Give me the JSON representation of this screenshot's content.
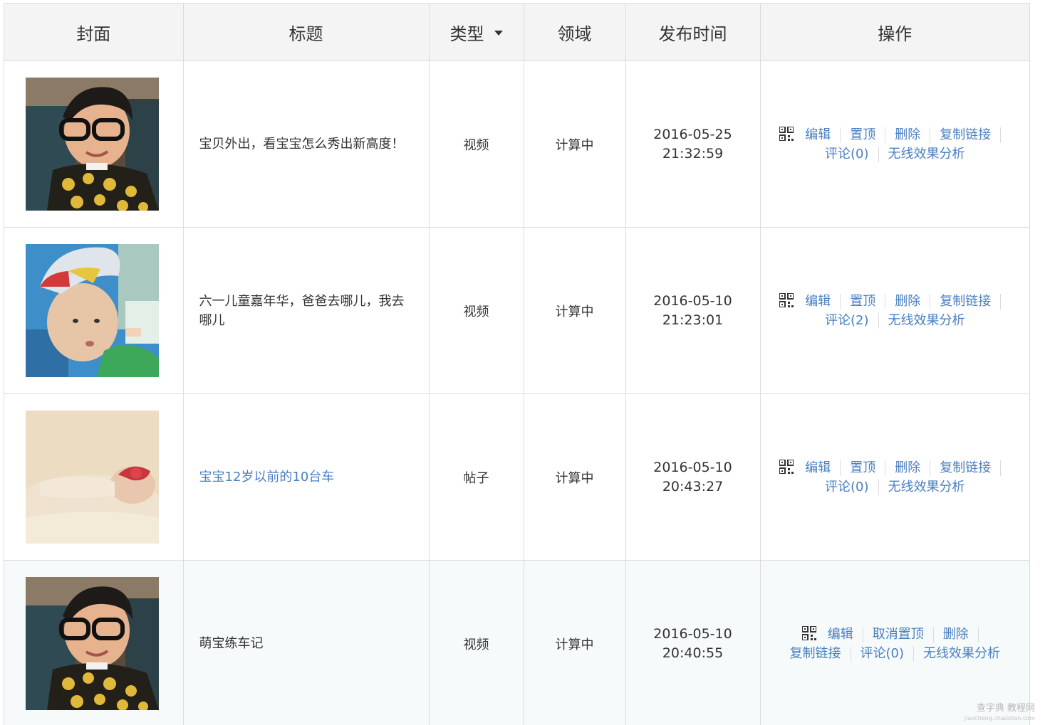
{
  "headers": {
    "cover": "封面",
    "title": "标题",
    "type": "类型",
    "domain": "领域",
    "publish_time": "发布时间",
    "actions": "操作"
  },
  "rows": [
    {
      "title": "宝贝外出，看宝宝怎么秀出新高度！",
      "title_is_link": false,
      "type": "视频",
      "domain": "计算中",
      "date": "2016-05-25",
      "time": "21:32:59",
      "actions": {
        "edit": "编辑",
        "pin": "置顶",
        "delete": "删除",
        "copy": "复制链接",
        "comment": "评论(0)",
        "analysis": "无线效果分析"
      }
    },
    {
      "title": "六一儿童嘉年华，爸爸去哪儿，我去哪儿",
      "title_is_link": false,
      "type": "视频",
      "domain": "计算中",
      "date": "2016-05-10",
      "time": "21:23:01",
      "actions": {
        "edit": "编辑",
        "pin": "置顶",
        "delete": "删除",
        "copy": "复制链接",
        "comment": "评论(2)",
        "analysis": "无线效果分析"
      }
    },
    {
      "title": "宝宝12岁以前的10台车",
      "title_is_link": true,
      "type": "帖子",
      "domain": "计算中",
      "date": "2016-05-10",
      "time": "20:43:27",
      "actions": {
        "edit": "编辑",
        "pin": "置顶",
        "delete": "删除",
        "copy": "复制链接",
        "comment": "评论(0)",
        "analysis": "无线效果分析"
      }
    },
    {
      "title": "萌宝练车记",
      "title_is_link": false,
      "type": "视频",
      "domain": "计算中",
      "date": "2016-05-10",
      "time": "20:40:55",
      "actions": {
        "edit": "编辑",
        "unpin": "取消置顶",
        "delete": "删除",
        "copy": "复制链接",
        "comment": "评论(0)",
        "analysis": "无线效果分析"
      }
    }
  ],
  "watermark": {
    "main": "查字典 教程网",
    "sub": "jiaocheng.chazidian.com"
  },
  "colors": {
    "link": "#4a7fc1",
    "header_bg": "#f4f4f4",
    "border": "#dcdcdc",
    "highlight_row_bg": "#f6fafa"
  },
  "icons": {
    "qr": "qr-code-icon",
    "sort": "caret-down-icon"
  }
}
